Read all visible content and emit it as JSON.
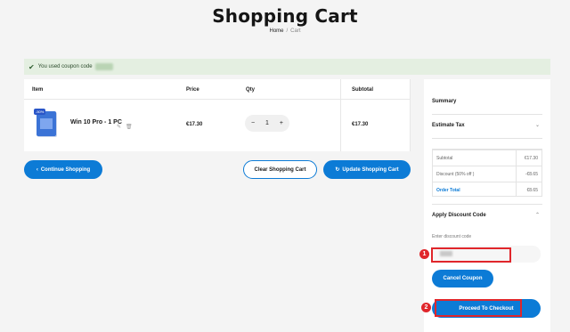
{
  "page": {
    "title": "Shopping Cart",
    "breadcrumb": {
      "home": "Home",
      "separator": "/",
      "current": "Cart"
    }
  },
  "notice": {
    "message": "You used coupon code"
  },
  "cart": {
    "headers": {
      "item": "Item",
      "price": "Price",
      "qty": "Qty",
      "subtotal": "Subtotal"
    },
    "items": [
      {
        "badge": "-50%",
        "name": "Win 10 Pro - 1 PC",
        "price": "€17.30",
        "qty": "1",
        "subtotal": "€17.30"
      }
    ]
  },
  "qty_controls": {
    "minus": "−",
    "plus": "+"
  },
  "actions": {
    "continue_shopping": "Continue Shopping",
    "clear_cart": "Clear Shopping Cart",
    "update_cart": "Update Shopping Cart"
  },
  "summary": {
    "title": "Summary",
    "estimate_tax": "Estimate Tax",
    "totals": [
      {
        "label": "Subtotal",
        "value": "€17.30"
      },
      {
        "label": "Discount (50% off )",
        "value": "-€8.65"
      },
      {
        "label": "Order Total",
        "value": "€8.65"
      }
    ],
    "apply_discount": "Apply Discount Code",
    "discount_label": "Enter discount code",
    "cancel_coupon": "Cancel Coupon",
    "proceed_checkout": "Proceed To Checkout"
  },
  "annotations": {
    "marker_1": "1",
    "marker_2": "2"
  },
  "colors": {
    "accent": "#0c7bd6",
    "annotation": "#e0262b",
    "notice_bg": "#e4efe1"
  }
}
